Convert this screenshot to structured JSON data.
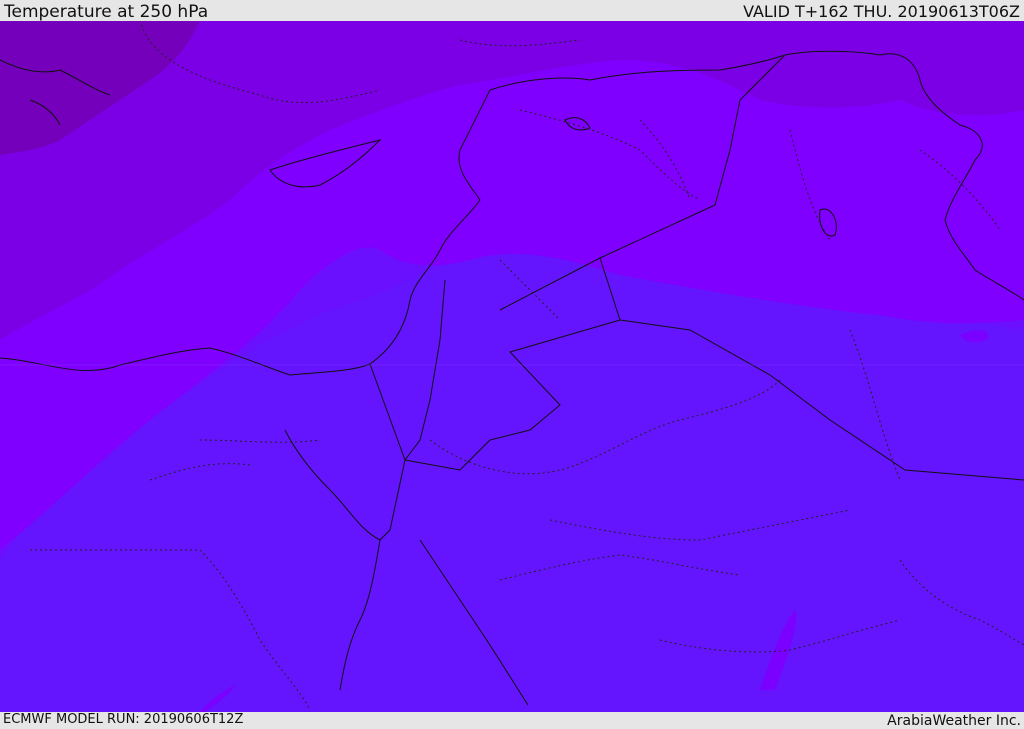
{
  "header": {
    "title": "Temperature at 250 hPa",
    "valid": "VALID T+162 THU. 20190613T06Z"
  },
  "footer": {
    "model_run": "ECMWF MODEL RUN: 20190606T12Z",
    "credit": "ArabiaWeather Inc."
  },
  "map": {
    "colors": {
      "coldest": "#7a00cc",
      "cold": "#8000ff",
      "mild": "#6b10ff",
      "warm": "#6514fe",
      "land_border": "#111111",
      "region_border": "#333333"
    }
  }
}
